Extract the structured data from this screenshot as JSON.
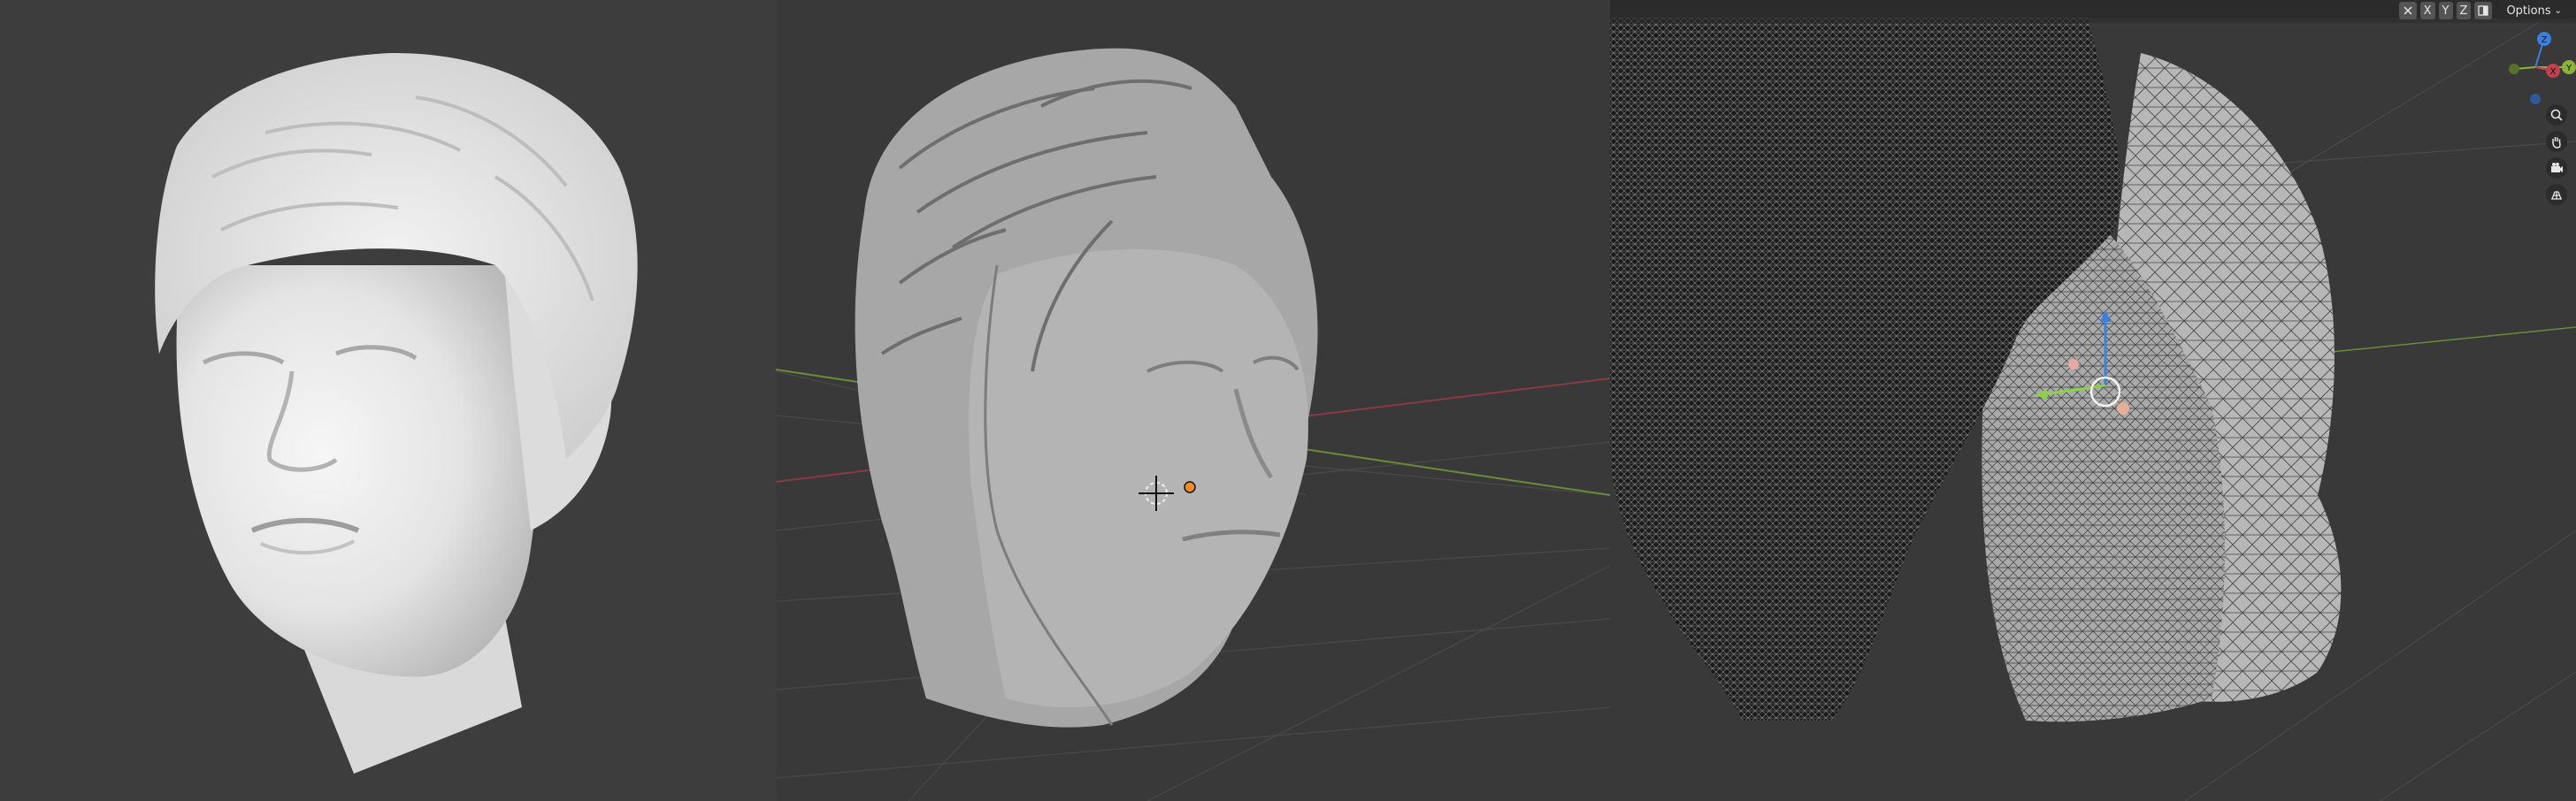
{
  "header": {
    "axis_x": "X",
    "axis_y": "Y",
    "axis_z": "Z",
    "options_label": "Options"
  },
  "gizmo": {
    "x_label": "X",
    "y_label": "Y",
    "z_label": "Z"
  },
  "icons": {
    "grid": "grid-toggle-icon",
    "layout": "layout-icon",
    "zoom": "zoom-icon",
    "pan": "hand-pan-icon",
    "camera": "camera-view-icon",
    "ortho": "orthographic-grid-icon"
  },
  "colors": {
    "viewport_bg": "#393939",
    "x_axis": "#c0414e",
    "y_axis": "#8bb33b",
    "z_axis": "#3d7fdd"
  }
}
